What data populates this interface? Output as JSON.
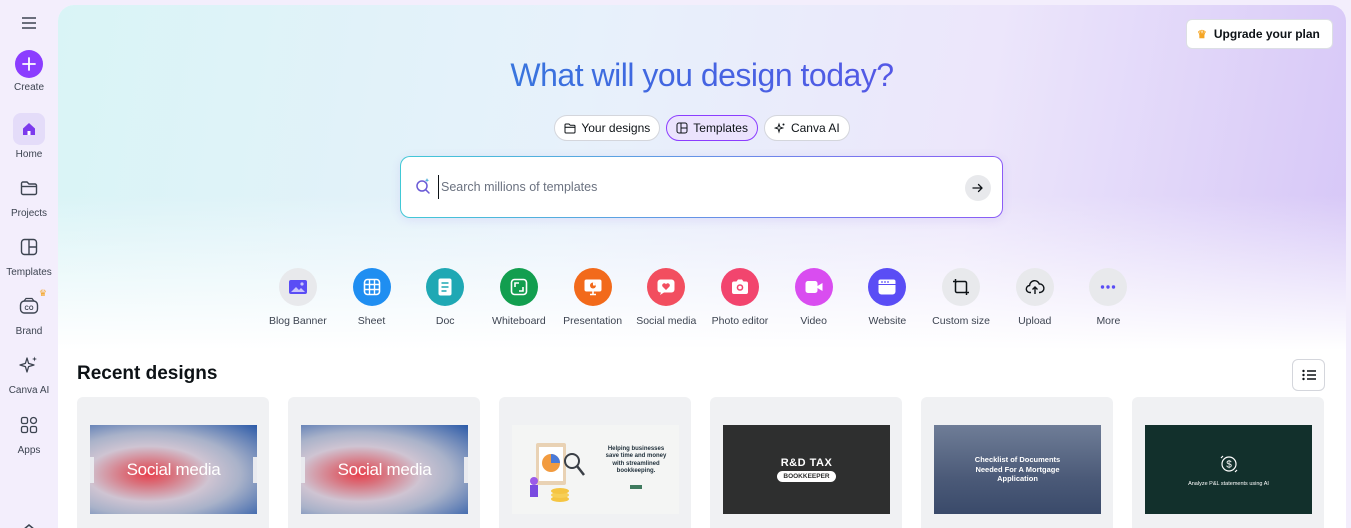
{
  "sidebar": {
    "items": [
      {
        "label": "Create"
      },
      {
        "label": "Home"
      },
      {
        "label": "Projects"
      },
      {
        "label": "Templates"
      },
      {
        "label": "Brand"
      },
      {
        "label": "Canva AI"
      },
      {
        "label": "Apps"
      }
    ]
  },
  "header": {
    "upgrade_label": "Upgrade your plan",
    "headline": "What will you design today?"
  },
  "tabs": [
    {
      "label": "Your designs",
      "active": false
    },
    {
      "label": "Templates",
      "active": true
    },
    {
      "label": "Canva AI",
      "active": false
    }
  ],
  "search": {
    "placeholder": "Search millions of templates"
  },
  "quick_actions": [
    {
      "label": "Blog Banner",
      "color": "#e8e9ec",
      "icon": "image-icon"
    },
    {
      "label": "Sheet",
      "color": "#1f8ef1",
      "icon": "grid-icon"
    },
    {
      "label": "Doc",
      "color": "#1fa8b4",
      "icon": "doc-icon"
    },
    {
      "label": "Whiteboard",
      "color": "#129e4f",
      "icon": "whiteboard-icon"
    },
    {
      "label": "Presentation",
      "color": "#f26a1b",
      "icon": "presentation-icon"
    },
    {
      "label": "Social media",
      "color": "#f24e5f",
      "icon": "heart-icon"
    },
    {
      "label": "Photo editor",
      "color": "#f2456e",
      "icon": "camera-icon"
    },
    {
      "label": "Video",
      "color": "#d94df0",
      "icon": "video-icon"
    },
    {
      "label": "Website",
      "color": "#5a4df5",
      "icon": "website-icon"
    },
    {
      "label": "Custom size",
      "color": "#e8e9ec",
      "icon": "crop-icon"
    },
    {
      "label": "Upload",
      "color": "#e8e9ec",
      "icon": "cloud-upload-icon"
    },
    {
      "label": "More",
      "color": "#e8e9ec",
      "icon": "more-icon"
    }
  ],
  "recent": {
    "title": "Recent designs",
    "cards": [
      {
        "thumb_text": "Social media"
      },
      {
        "thumb_text": "Social media"
      },
      {
        "thumb_text": "Helping businesses save time and money with streamlined bookkeeping."
      },
      {
        "thumb_text": "R&D TAX",
        "thumb_sub": "BOOKKEEPER"
      },
      {
        "thumb_text": "Checklist of Documents Needed For A Mortgage Application"
      },
      {
        "thumb_text": "Analyze P&L statements using AI"
      }
    ]
  }
}
